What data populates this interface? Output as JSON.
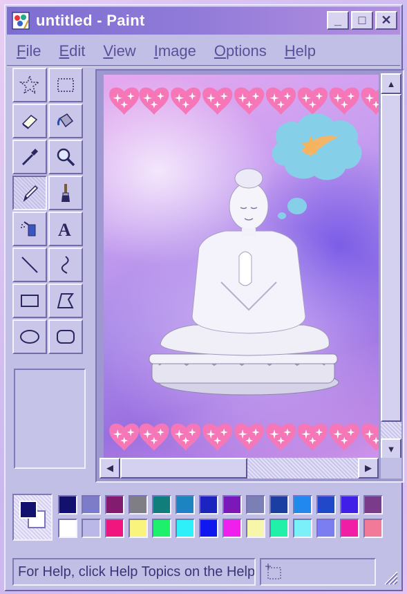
{
  "window": {
    "title": "untitled - Paint",
    "controls": {
      "minimize": "_",
      "maximize": "□",
      "close": "✕"
    }
  },
  "menu": [
    {
      "label": "File",
      "key": "F",
      "rest": "ile"
    },
    {
      "label": "Edit",
      "key": "E",
      "rest": "dit"
    },
    {
      "label": "View",
      "key": "V",
      "rest": "iew"
    },
    {
      "label": "Image",
      "key": "I",
      "rest": "mage"
    },
    {
      "label": "Options",
      "key": "O",
      "rest": "ptions"
    },
    {
      "label": "Help",
      "key": "H",
      "rest": "elp"
    }
  ],
  "tools": [
    {
      "name": "free-form-select",
      "icon": "star-select-icon",
      "active": false
    },
    {
      "name": "rect-select",
      "icon": "rect-select-icon",
      "active": false
    },
    {
      "name": "eraser",
      "icon": "eraser-icon",
      "active": false
    },
    {
      "name": "fill",
      "icon": "paint-bucket-icon",
      "active": false
    },
    {
      "name": "pick-color",
      "icon": "eyedropper-icon",
      "active": false
    },
    {
      "name": "magnifier",
      "icon": "magnifier-icon",
      "active": false
    },
    {
      "name": "pencil",
      "icon": "pencil-icon",
      "active": true
    },
    {
      "name": "brush",
      "icon": "brush-icon",
      "active": false
    },
    {
      "name": "airbrush",
      "icon": "airbrush-icon",
      "active": false
    },
    {
      "name": "text",
      "icon": "text-icon",
      "active": false
    },
    {
      "name": "line",
      "icon": "line-icon",
      "active": false
    },
    {
      "name": "curve",
      "icon": "curve-icon",
      "active": false
    },
    {
      "name": "rectangle",
      "icon": "rectangle-icon",
      "active": false
    },
    {
      "name": "polygon",
      "icon": "polygon-icon",
      "active": false
    },
    {
      "name": "ellipse",
      "icon": "ellipse-icon",
      "active": false
    },
    {
      "name": "rounded-rectangle",
      "icon": "rounded-rectangle-icon",
      "active": false
    }
  ],
  "canvas_art": {
    "description_icons": [
      "hearts-border",
      "buddha-statue",
      "thought-bubble",
      "shooting-star"
    ]
  },
  "colors": {
    "foreground": "#12126e",
    "background": "#ffffff",
    "palette_row1": [
      "#12126e",
      "#7c7cc8",
      "#821c6e",
      "#7e7e84",
      "#107e7a",
      "#1c84c0",
      "#1c24c0",
      "#7a18b8",
      "#7a80b4",
      "#1a3ea2",
      "#2088ee",
      "#2048c8",
      "#4020e8",
      "#7a3c8a"
    ],
    "palette_row2": [
      "#ffffff",
      "#bab8e6",
      "#f0167e",
      "#f8f47c",
      "#1ef06e",
      "#2ef0f8",
      "#1018f0",
      "#f020ec",
      "#f8f6a8",
      "#20f0a8",
      "#7cf0f8",
      "#7a7ef0",
      "#f01ea4",
      "#f07a98"
    ]
  },
  "status": {
    "help_text": "For Help, click Help Topics on the Help Menu."
  }
}
